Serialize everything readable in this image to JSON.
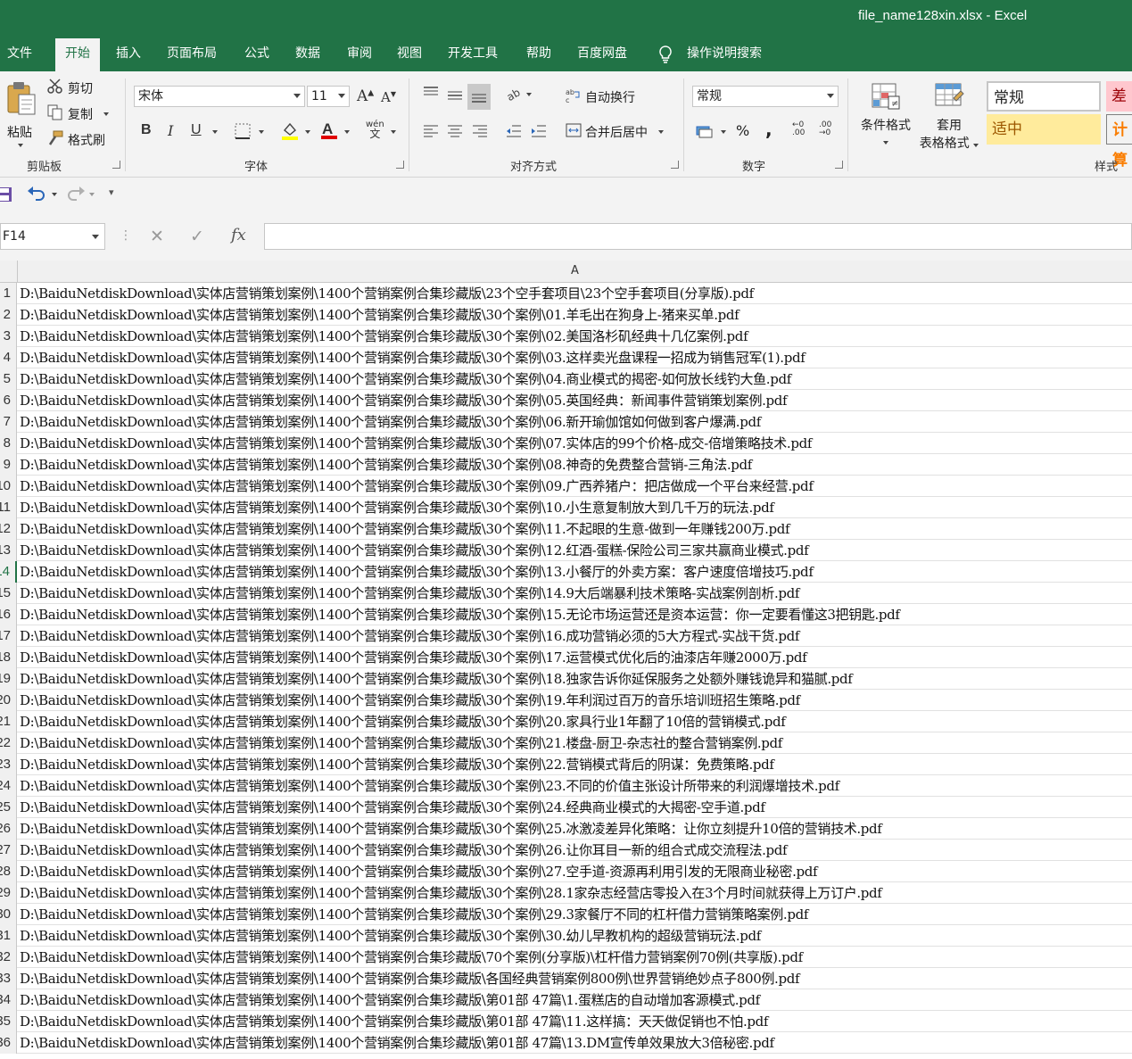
{
  "window": {
    "title": "file_name128xin.xlsx  -  Excel"
  },
  "tabs": [
    "文件",
    "开始",
    "插入",
    "页面布局",
    "公式",
    "数据",
    "审阅",
    "视图",
    "开发工具",
    "帮助",
    "百度网盘",
    "操作说明搜索"
  ],
  "ribbon": {
    "clipboard": {
      "label": "剪贴板",
      "paste": "粘贴",
      "cut": "剪切",
      "copy": "复制",
      "format_painter": "格式刷"
    },
    "font": {
      "label": "字体",
      "font_name": "宋体",
      "font_size": "11",
      "bold": "B",
      "italic": "I",
      "underline": "U",
      "wen": "wén\n文"
    },
    "alignment": {
      "label": "对齐方式",
      "wrap": "自动换行",
      "merge": "合并后居中"
    },
    "number": {
      "label": "数字",
      "format": "常规",
      "percent": "%",
      "comma": ","
    },
    "styles": {
      "label": "样式",
      "cond_format": "条件格式",
      "table_format_1": "套用",
      "table_format_2": "表格格式",
      "normal": "常规",
      "bad": "差",
      "neutral": "适中",
      "calc": "计算"
    }
  },
  "formula_bar": {
    "name_box": "F14",
    "fx": "fx",
    "value": ""
  },
  "sheet": {
    "column": "A",
    "selected_row": 14,
    "rows": [
      "D:\\BaiduNetdiskDownload\\实体店营销策划案例\\1400个营销案例合集珍藏版\\23个空手套项目\\23个空手套项目(分享版).pdf",
      "D:\\BaiduNetdiskDownload\\实体店营销策划案例\\1400个营销案例合集珍藏版\\30个案例\\01.羊毛出在狗身上-猪来买单.pdf",
      "D:\\BaiduNetdiskDownload\\实体店营销策划案例\\1400个营销案例合集珍藏版\\30个案例\\02.美国洛杉矶经典十几亿案例.pdf",
      "D:\\BaiduNetdiskDownload\\实体店营销策划案例\\1400个营销案例合集珍藏版\\30个案例\\03.这样卖光盘课程一招成为销售冠军(1).pdf",
      "D:\\BaiduNetdiskDownload\\实体店营销策划案例\\1400个营销案例合集珍藏版\\30个案例\\04.商业模式的揭密-如何放长线钓大鱼.pdf",
      "D:\\BaiduNetdiskDownload\\实体店营销策划案例\\1400个营销案例合集珍藏版\\30个案例\\05.英国经典：新闻事件营销策划案例.pdf",
      "D:\\BaiduNetdiskDownload\\实体店营销策划案例\\1400个营销案例合集珍藏版\\30个案例\\06.新开瑜伽馆如何做到客户爆满.pdf",
      "D:\\BaiduNetdiskDownload\\实体店营销策划案例\\1400个营销案例合集珍藏版\\30个案例\\07.实体店的99个价格-成交-倍增策略技术.pdf",
      "D:\\BaiduNetdiskDownload\\实体店营销策划案例\\1400个营销案例合集珍藏版\\30个案例\\08.神奇的免费整合营销-三角法.pdf",
      "D:\\BaiduNetdiskDownload\\实体店营销策划案例\\1400个营销案例合集珍藏版\\30个案例\\09.广西养猪户：把店做成一个平台来经营.pdf",
      "D:\\BaiduNetdiskDownload\\实体店营销策划案例\\1400个营销案例合集珍藏版\\30个案例\\10.小生意复制放大到几千万的玩法.pdf",
      "D:\\BaiduNetdiskDownload\\实体店营销策划案例\\1400个营销案例合集珍藏版\\30个案例\\11.不起眼的生意-做到一年赚钱200万.pdf",
      "D:\\BaiduNetdiskDownload\\实体店营销策划案例\\1400个营销案例合集珍藏版\\30个案例\\12.红酒-蛋糕-保险公司三家共赢商业模式.pdf",
      "D:\\BaiduNetdiskDownload\\实体店营销策划案例\\1400个营销案例合集珍藏版\\30个案例\\13.小餐厅的外卖方案：客户速度倍增技巧.pdf",
      "D:\\BaiduNetdiskDownload\\实体店营销策划案例\\1400个营销案例合集珍藏版\\30个案例\\14.9大后端暴利技术策略-实战案例剖析.pdf",
      "D:\\BaiduNetdiskDownload\\实体店营销策划案例\\1400个营销案例合集珍藏版\\30个案例\\15.无论市场运营还是资本运营：你一定要看懂这3把钥匙.pdf",
      "D:\\BaiduNetdiskDownload\\实体店营销策划案例\\1400个营销案例合集珍藏版\\30个案例\\16.成功营销必须的5大方程式-实战干货.pdf",
      "D:\\BaiduNetdiskDownload\\实体店营销策划案例\\1400个营销案例合集珍藏版\\30个案例\\17.运营模式优化后的油漆店年赚2000万.pdf",
      "D:\\BaiduNetdiskDownload\\实体店营销策划案例\\1400个营销案例合集珍藏版\\30个案例\\18.独家告诉你延保服务之处额外赚钱诡异和猫腻.pdf",
      "D:\\BaiduNetdiskDownload\\实体店营销策划案例\\1400个营销案例合集珍藏版\\30个案例\\19.年利润过百万的音乐培训班招生策略.pdf",
      "D:\\BaiduNetdiskDownload\\实体店营销策划案例\\1400个营销案例合集珍藏版\\30个案例\\20.家具行业1年翻了10倍的营销模式.pdf",
      "D:\\BaiduNetdiskDownload\\实体店营销策划案例\\1400个营销案例合集珍藏版\\30个案例\\21.楼盘-厨卫-杂志社的整合营销案例.pdf",
      "D:\\BaiduNetdiskDownload\\实体店营销策划案例\\1400个营销案例合集珍藏版\\30个案例\\22.营销模式背后的阴谋：免费策略.pdf",
      "D:\\BaiduNetdiskDownload\\实体店营销策划案例\\1400个营销案例合集珍藏版\\30个案例\\23.不同的价值主张设计所带来的利润爆增技术.pdf",
      "D:\\BaiduNetdiskDownload\\实体店营销策划案例\\1400个营销案例合集珍藏版\\30个案例\\24.经典商业模式的大揭密-空手道.pdf",
      "D:\\BaiduNetdiskDownload\\实体店营销策划案例\\1400个营销案例合集珍藏版\\30个案例\\25.冰激凌差异化策略：让你立刻提升10倍的营销技术.pdf",
      "D:\\BaiduNetdiskDownload\\实体店营销策划案例\\1400个营销案例合集珍藏版\\30个案例\\26.让你耳目一新的组合式成交流程法.pdf",
      "D:\\BaiduNetdiskDownload\\实体店营销策划案例\\1400个营销案例合集珍藏版\\30个案例\\27.空手道-资源再利用引发的无限商业秘密.pdf",
      "D:\\BaiduNetdiskDownload\\实体店营销策划案例\\1400个营销案例合集珍藏版\\30个案例\\28.1家杂志经营店零投入在3个月时间就获得上万订户.pdf",
      "D:\\BaiduNetdiskDownload\\实体店营销策划案例\\1400个营销案例合集珍藏版\\30个案例\\29.3家餐厅不同的杠杆借力营销策略案例.pdf",
      "D:\\BaiduNetdiskDownload\\实体店营销策划案例\\1400个营销案例合集珍藏版\\30个案例\\30.幼儿早教机构的超级营销玩法.pdf",
      "D:\\BaiduNetdiskDownload\\实体店营销策划案例\\1400个营销案例合集珍藏版\\70个案例(分享版)\\杠杆借力营销案例70例(共享版).pdf",
      "D:\\BaiduNetdiskDownload\\实体店营销策划案例\\1400个营销案例合集珍藏版\\各国经典营销案例800例\\世界营销绝妙点子800例.pdf",
      "D:\\BaiduNetdiskDownload\\实体店营销策划案例\\1400个营销案例合集珍藏版\\第01部  47篇\\1.蛋糕店的自动增加客源模式.pdf",
      "D:\\BaiduNetdiskDownload\\实体店营销策划案例\\1400个营销案例合集珍藏版\\第01部  47篇\\11.这样搞：天天做促销也不怕.pdf",
      "D:\\BaiduNetdiskDownload\\实体店营销策划案例\\1400个营销案例合集珍藏版\\第01部  47篇\\13.DM宣传单效果放大3倍秘密.pdf"
    ]
  },
  "colors": {
    "excel_green": "#217346",
    "ribbon_bg": "#f3f3f3",
    "bad_bg": "#ffc7ce",
    "neutral_bg": "#ffeb9c"
  },
  "icons": [
    "paste-icon",
    "scissors-icon",
    "copy-icon",
    "brush-icon",
    "lightbulb-icon",
    "save-icon",
    "undo-icon",
    "redo-icon"
  ]
}
